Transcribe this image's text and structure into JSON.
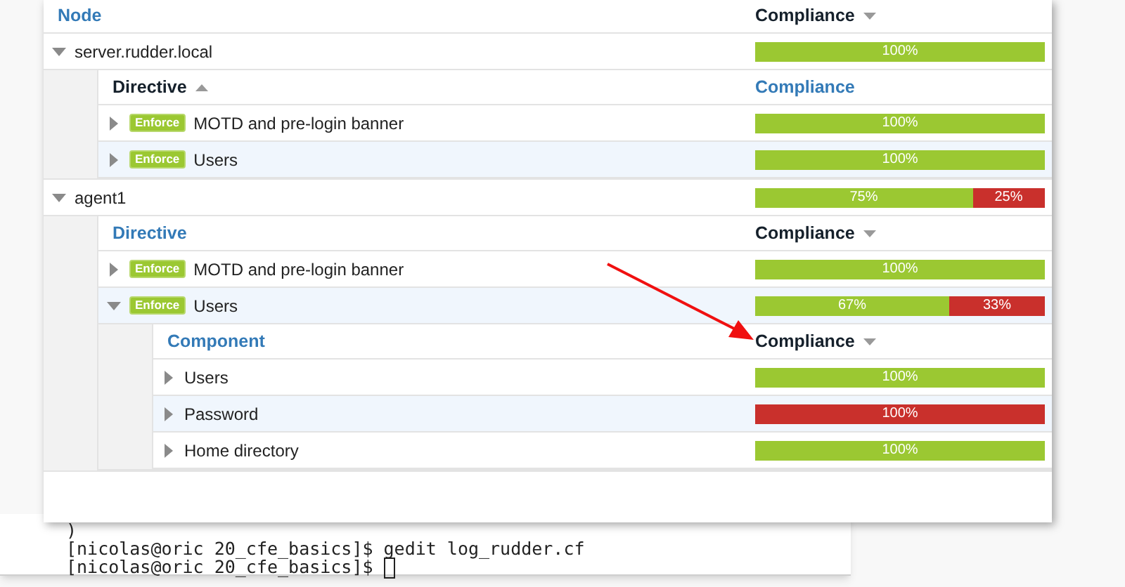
{
  "table": {
    "columns": [
      {
        "label": "Node",
        "kind": "sortable"
      },
      {
        "label": "Compliance",
        "kind": "descending"
      }
    ],
    "rows": [
      {
        "name": "server.rudder.local",
        "expanded": true,
        "compliance": [
          {
            "kind": "success",
            "level": 1,
            "label": "100%"
          }
        ],
        "subtable": {
          "columns": [
            {
              "label": "Directive",
              "kind": "ascending"
            },
            {
              "label": "Compliance",
              "kind": "sortable"
            }
          ],
          "rows": [
            {
              "badge": "Enforce",
              "name": "MOTD and pre-login banner",
              "expanded": false,
              "compliance": [
                {
                  "kind": "success",
                  "level": 1,
                  "label": "100%"
                }
              ]
            },
            {
              "badge": "Enforce",
              "name": "Users",
              "expanded": false,
              "compliance": [
                {
                  "kind": "success",
                  "level": 1,
                  "label": "100%"
                }
              ]
            }
          ]
        }
      },
      {
        "name": "agent1",
        "expanded": true,
        "compliance": [
          {
            "kind": "success",
            "level": 0.75,
            "label": "75%"
          },
          {
            "kind": "error",
            "level": 0.25,
            "label": "25%"
          }
        ],
        "subtable": {
          "columns": [
            {
              "label": "Directive",
              "kind": "sortable"
            },
            {
              "label": "Compliance",
              "kind": "descending"
            }
          ],
          "rows": [
            {
              "badge": "Enforce",
              "name": "MOTD and pre-login banner",
              "expanded": false,
              "compliance": [
                {
                  "kind": "success",
                  "level": 1,
                  "label": "100%"
                }
              ]
            },
            {
              "badge": "Enforce",
              "name": "Users",
              "expanded": true,
              "compliance": [
                {
                  "kind": "success",
                  "level": 0.67,
                  "label": "67%"
                },
                {
                  "kind": "error",
                  "level": 0.33,
                  "label": "33%"
                }
              ],
              "subtable": {
                "columns": [
                  {
                    "label": "Component",
                    "kind": "sortable"
                  },
                  {
                    "label": "Compliance",
                    "kind": "descending"
                  }
                ],
                "rows": [
                  {
                    "name": "Users",
                    "expanded": false,
                    "compliance": [
                      {
                        "kind": "success",
                        "level": 1,
                        "label": "100%"
                      }
                    ]
                  },
                  {
                    "name": "Password",
                    "expanded": false,
                    "compliance": [
                      {
                        "kind": "error",
                        "level": 1,
                        "label": "100%"
                      }
                    ]
                  },
                  {
                    "name": "Home directory",
                    "expanded": false,
                    "compliance": [
                      {
                        "kind": "success",
                        "level": 1,
                        "label": "100%"
                      }
                    ]
                  }
                ]
              }
            }
          ]
        }
      }
    ]
  },
  "terminal": {
    "lines": [
      ")",
      "[nicolas@oric 20_cfe_basics]$ gedit log_rudder.cf",
      "[nicolas@oric 20_cfe_basics]$"
    ]
  }
}
